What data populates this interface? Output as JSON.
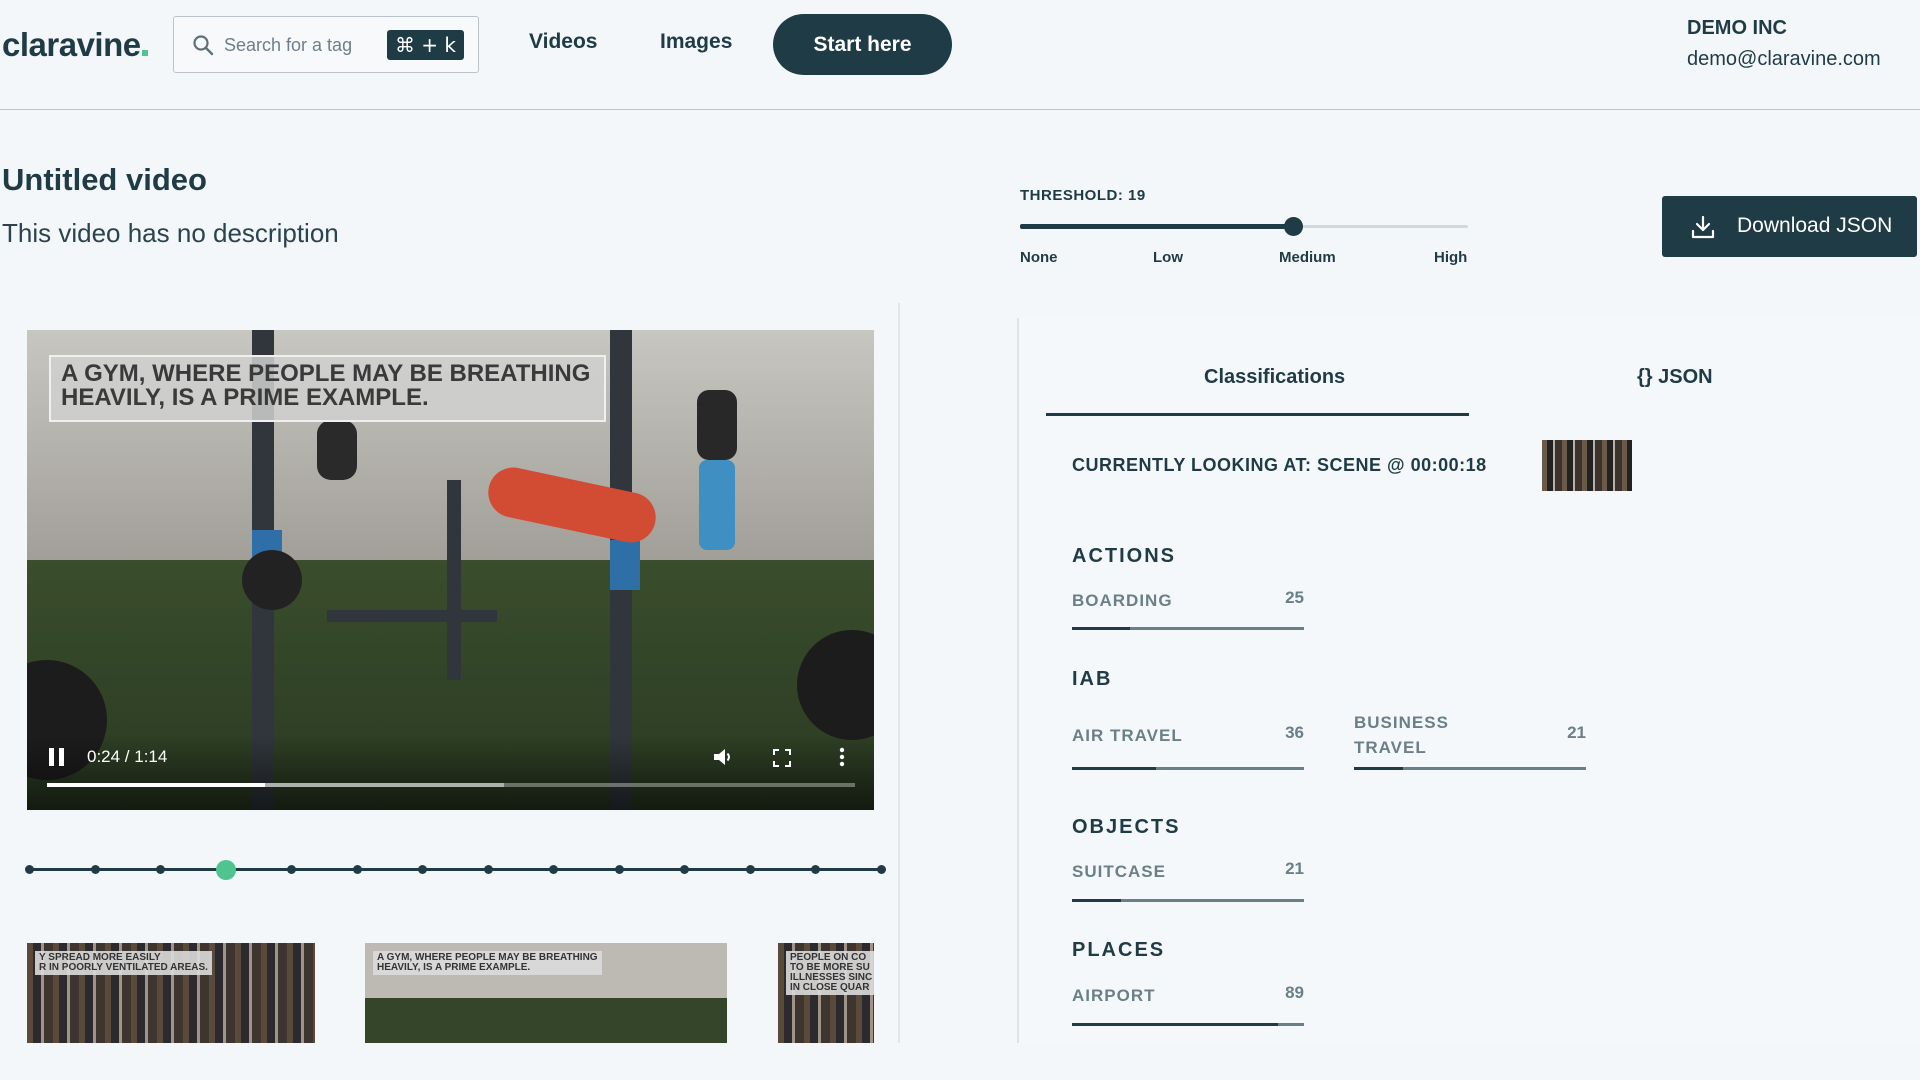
{
  "header": {
    "logo_text": "claravine",
    "search": {
      "placeholder": "Search for a tag",
      "shortcut": "⌘ + k"
    },
    "nav": [
      {
        "label": "Videos"
      },
      {
        "label": "Images"
      }
    ],
    "cta_label": "Start here",
    "account": {
      "company": "DEMO INC",
      "email": "demo@claravine.com"
    }
  },
  "video_info": {
    "title": "Untitled video",
    "description": "This video has no description"
  },
  "threshold": {
    "label": "THRESHOLD: 19",
    "value_fraction": 0.61,
    "ticks": [
      "None",
      "Low",
      "Medium",
      "High"
    ]
  },
  "download_label": "Download JSON",
  "player": {
    "caption_line1": "A GYM, WHERE PEOPLE MAY BE BREATHING",
    "caption_line2": "HEAVILY, IS A PRIME EXAMPLE.",
    "time": "0:24 / 1:14",
    "played_fraction": 0.27,
    "buffered_fraction": 0.565
  },
  "timeline": {
    "markers": 14,
    "active_index": 3
  },
  "thumbnails": [
    {
      "caption": "Y SPREAD MORE EASILY\nR IN POORLY VENTILATED AREAS."
    },
    {
      "caption": "A GYM, WHERE PEOPLE MAY BE BREATHING\nHEAVILY, IS A PRIME EXAMPLE."
    },
    {
      "caption": "PEOPLE ON CO\nTO BE MORE SU\nILLNESSES SINC\nIN CLOSE QUAR"
    }
  ],
  "classifications": {
    "tabs": [
      {
        "label": "Classifications"
      },
      {
        "label": "{} JSON"
      }
    ],
    "currently_looking": "CURRENTLY LOOKING AT:  SCENE @ 00:00:18",
    "sections": [
      {
        "title": "ACTIONS",
        "tags": [
          {
            "name": "BOARDING",
            "score": "25"
          }
        ]
      },
      {
        "title": "IAB",
        "tags": [
          {
            "name": "AIR TRAVEL",
            "score": "36"
          },
          {
            "name": "BUSINESS TRAVEL",
            "score": "21"
          }
        ]
      },
      {
        "title": "OBJECTS",
        "tags": [
          {
            "name": "SUITCASE",
            "score": "21"
          }
        ]
      },
      {
        "title": "PLACES",
        "tags": [
          {
            "name": "AIRPORT",
            "score": "89"
          }
        ]
      }
    ]
  },
  "colors": {
    "primary": "#1f3b45",
    "accent": "#4fc48f",
    "muted": "#6a7f88",
    "background": "#f4f7fa"
  }
}
